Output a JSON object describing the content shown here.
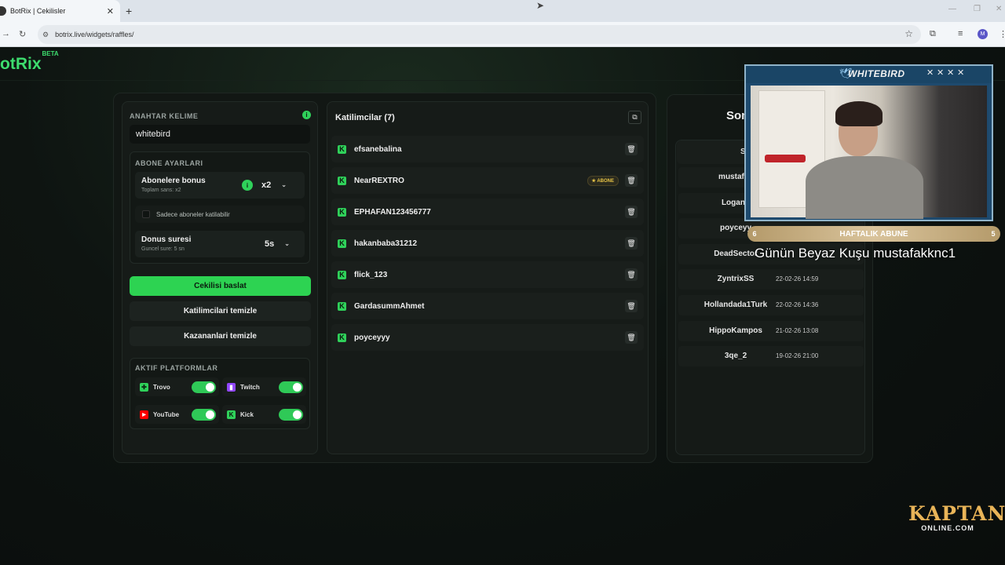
{
  "browser": {
    "tab_title": "BotRix | Cekilisler",
    "tab_close": "✕",
    "new_tab": "+",
    "url": "botrix.live/widgets/raffles/",
    "avatar_letter": "M"
  },
  "app": {
    "logo": "otRix",
    "logo_badge": "BETA",
    "brand_color": "#2fd15a"
  },
  "settings": {
    "keyword_label": "ANAHTAR KELIME",
    "keyword_value": "whitebird",
    "sub_settings_label": "ABONE AYARLARI",
    "bonus_title": "Abonelere bonus",
    "bonus_sub": "Toplam sans: x2",
    "bonus_value": "x2",
    "only_subs_label": "Sadece aboneler katilabilir",
    "duration_title": "Donus suresi",
    "duration_sub": "Guncel sure: 5 sn",
    "duration_value": "5s",
    "start_button": "Cekilisi baslat",
    "clear_participants_button": "Katilimcilari temizle",
    "clear_winners_button": "Kazananlari temizle",
    "platforms_label": "AKTIF PLATFORMLAR",
    "platforms": [
      {
        "name": "Trovo",
        "enabled": true,
        "icon": "trovo-icon"
      },
      {
        "name": "Twitch",
        "enabled": true,
        "icon": "twitch-icon"
      },
      {
        "name": "YouTube",
        "enabled": true,
        "icon": "youtube-icon"
      },
      {
        "name": "Kick",
        "enabled": true,
        "icon": "kick-icon"
      }
    ]
  },
  "participants": {
    "title": "Katilimcilar (7)",
    "subscriber_badge": "ABONE",
    "items": [
      {
        "name": "efsanebalina",
        "platform": "kick-icon"
      },
      {
        "name": "NearREXTRO",
        "platform": "kick-icon",
        "subscriber": true
      },
      {
        "name": "EPHAFAN123456777",
        "platform": "kick-icon"
      },
      {
        "name": "hakanbaba31212",
        "platform": "kick-icon"
      },
      {
        "name": "flick_123",
        "platform": "kick-icon"
      },
      {
        "name": "GardasummAhmet",
        "platform": "kick-icon"
      },
      {
        "name": "poyceyyy",
        "platform": "kick-icon"
      }
    ]
  },
  "winners": {
    "title": "Son",
    "header": "S",
    "items": [
      {
        "name": "mustafak",
        "date": ""
      },
      {
        "name": "Loganb",
        "date": ""
      },
      {
        "name": "poyceyy",
        "date": ""
      },
      {
        "name": "DeadSector",
        "date": ""
      },
      {
        "name": "ZyntrixSS",
        "date": "22-02-26 14:59"
      },
      {
        "name": "Hollandada1Turk",
        "date": "22-02-26 14:36"
      },
      {
        "name": "HippoKampos",
        "date": "21-02-26 13:08"
      },
      {
        "name": "3qe_2",
        "date": "19-02-26 21:00"
      }
    ]
  },
  "overlay": {
    "brand": "WHITEBIRD",
    "sub_goal_left": "6",
    "sub_goal_text": "HAFTALIK ABUNE",
    "sub_goal_right": "5",
    "caption": "Günün Beyaz Kuşu mustafakknc1",
    "watermark_big": "KAPTAN",
    "watermark_small": "ONLINE.COM"
  }
}
